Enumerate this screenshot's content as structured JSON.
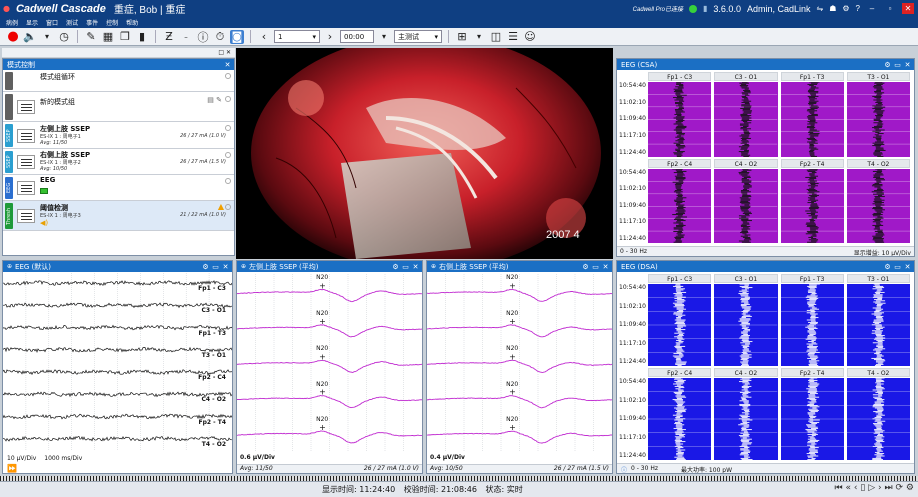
{
  "titlebar": {
    "brand": "Cadwell Cascade",
    "patient": "重症, Bob | 重症",
    "pro_label": "Cadwell Pro已连接",
    "version": "3.6.0.0",
    "user": "Admin, CadLink"
  },
  "menu": [
    "病例",
    "显示",
    "窗口",
    "测试",
    "事件",
    "控制",
    "帮助"
  ],
  "toolbar": {
    "page_value": "1",
    "time_value": "00:00",
    "test_select": "主测试"
  },
  "mode_control": {
    "title": "模式控制",
    "rows": [
      {
        "tag": "",
        "tag_color": "#606060",
        "name": "模式组循环",
        "bold": false,
        "sub1": "",
        "sub2": "",
        "value": "",
        "thumb": false
      },
      {
        "tag": "",
        "tag_color": "#606060",
        "name": "新的模式组",
        "bold": false,
        "sub1": "",
        "sub2": "",
        "value": "",
        "thumb": true
      },
      {
        "tag": "SSEP",
        "tag_color": "#2b9fd0",
        "name": "左侧上肢 SSEP",
        "bold": true,
        "sub1": "ES-IX 1 : 周电子1",
        "sub2": "Avg: 11/50",
        "value": "26 / 27 mA (1.0 V)",
        "thumb": true
      },
      {
        "tag": "SSEP",
        "tag_color": "#2b9fd0",
        "name": "右侧上肢 SSEP",
        "bold": true,
        "sub1": "ES-IX 1 : 周电子2",
        "sub2": "Avg: 10/50",
        "value": "26 / 27 mA (1.5 V)",
        "thumb": true
      },
      {
        "tag": "EEG",
        "tag_color": "#2b6fd0",
        "name": "EEG",
        "bold": true,
        "sub1": "",
        "sub2": "",
        "value": "",
        "thumb": true
      },
      {
        "tag": "Thresh",
        "tag_color": "#1f9a3a",
        "name": "阈值检测",
        "bold": true,
        "sub1": "ES-IX 1 : 周电子3",
        "sub2": "",
        "value": "21 / 22 mA (1.0 V)",
        "thumb": true
      }
    ]
  },
  "video": {
    "timestamp": "2007  4"
  },
  "csa_top": {
    "title": "EEG (CSA)",
    "channels_row1": [
      "Fp1 - C3",
      "C3 - O1",
      "Fp1 - T3",
      "T3 - O1"
    ],
    "channels_row2": [
      "Fp2 - C4",
      "C4 - O2",
      "Fp2 - T4",
      "T4 - O2"
    ],
    "times": [
      "10:54:40",
      "11:02:10",
      "11:09:40",
      "11:17:10",
      "11:24:40"
    ],
    "bg_color": "#a019c8",
    "footer_left": "0 - 30 Hz",
    "footer_right": "显示增益: 10 µV/Div"
  },
  "csa_bottom": {
    "title": "EEG (DSA)",
    "channels_row1": [
      "Fp1 - C3",
      "C3 - O1",
      "Fp1 - T3",
      "T3 - O1"
    ],
    "channels_row2": [
      "Fp2 - C4",
      "C4 - O2",
      "Fp2 - T4",
      "T4 - O2"
    ],
    "times": [
      "10:54:40",
      "11:02:10",
      "11:09:40",
      "11:17:10",
      "11:24:40"
    ],
    "bg_color": "#1a18e6",
    "footer_left": "0 - 30 Hz",
    "footer_right": "最大功率: 100 pW"
  },
  "eeg_default": {
    "title": "EEG (默认)",
    "channels": [
      "Fp1 - C3",
      "C3 - O1",
      "Fp1 - T3",
      "T3 - O1",
      "Fp2 - C4",
      "C4 - O2",
      "Fp2 - T4",
      "T4 - O2"
    ],
    "gain": "10 µV/Div",
    "sweep": "1000 ms/Div"
  },
  "ssep_left": {
    "title": "左侧上肢 SSEP (平均)",
    "peak_label": "N20",
    "gain": "0.6 µV/Div",
    "avg": "Avg: 11/50",
    "stim": "26 / 27 mA (1.0 V)"
  },
  "ssep_right": {
    "title": "右侧上肢 SSEP (平均)",
    "peak_label": "N20",
    "gain": "0.4 µV/Div",
    "avg": "Avg: 10/50",
    "stim": "26 / 27 mA (1.5 V)"
  },
  "status": {
    "display_time_label": "显示时间:",
    "display_time": "11:24:40",
    "calib_label": "校验时间:",
    "calib_time": "21:08:46",
    "state_label": "状态:",
    "state": "实时"
  },
  "colors": {
    "title_bar": "#0f3f82",
    "panel_header": "#1b6fc4",
    "ssep_trace": "#c02ad0"
  }
}
